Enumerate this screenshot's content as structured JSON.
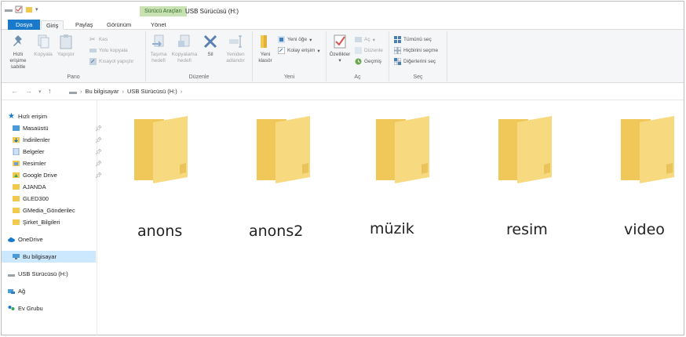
{
  "titlebar": {
    "context_tab": "Sürücü Araçları",
    "title": "USB Sürücüsü (H:)"
  },
  "tabs": [
    "Dosya",
    "Giriş",
    "Paylaş",
    "Görünüm",
    "Yönet"
  ],
  "ribbon": {
    "pano": {
      "label": "Pano",
      "pin_quick": "Hızlı erişime sabitle",
      "copy": "Kopyala",
      "paste": "Yapıştır",
      "cut": "Kes",
      "copy_path": "Yolu kopyala",
      "paste_shortcut": "Kısayol yapıştır"
    },
    "duzenle": {
      "label": "Düzenle",
      "move_to": "Taşıma hedefi",
      "copy_to": "Kopyalama hedefi",
      "delete": "Sil",
      "rename": "Yeniden adlandır"
    },
    "yeni": {
      "label": "Yeni",
      "new_folder": "Yeni klasör",
      "new_item": "Yeni öğe",
      "easy_access": "Kolay erişim"
    },
    "ac": {
      "label": "Aç",
      "properties": "Özellikler",
      "open": "Aç",
      "edit": "Düzenle",
      "history": "Geçmiş"
    },
    "sec": {
      "label": "Seç",
      "select_all": "Tümünü seç",
      "select_none": "Hiçbirini seçme",
      "invert": "Diğerlerini seç"
    }
  },
  "address": {
    "crumbs": [
      "Bu bilgisayar",
      "USB Sürücüsü (H:)"
    ]
  },
  "navpane": {
    "quick_access": "Hızlı erişim",
    "items": [
      {
        "label": "Masaüstü",
        "pinned": true
      },
      {
        "label": "İndirilenler",
        "pinned": true
      },
      {
        "label": "Belgeler",
        "pinned": true
      },
      {
        "label": "Resimler",
        "pinned": true
      },
      {
        "label": "Google Drive",
        "pinned": true
      },
      {
        "label": "AJANDA",
        "pinned": false
      },
      {
        "label": "GLED300",
        "pinned": false
      },
      {
        "label": "GMedia_Gönderilec",
        "pinned": false
      },
      {
        "label": "Şirket_Bilgileri",
        "pinned": false
      }
    ],
    "onedrive": "OneDrive",
    "this_pc": "Bu bilgisayar",
    "usb": "USB Sürücüsü (H:)",
    "network": "Ağ",
    "homegroup": "Ev Grubu"
  },
  "folders": [
    "anons",
    "anons2",
    "müzik",
    "resim",
    "video"
  ],
  "colors": {
    "accent": "#1979ca",
    "folder": "#f5d67a",
    "selected": "#cce8ff"
  }
}
